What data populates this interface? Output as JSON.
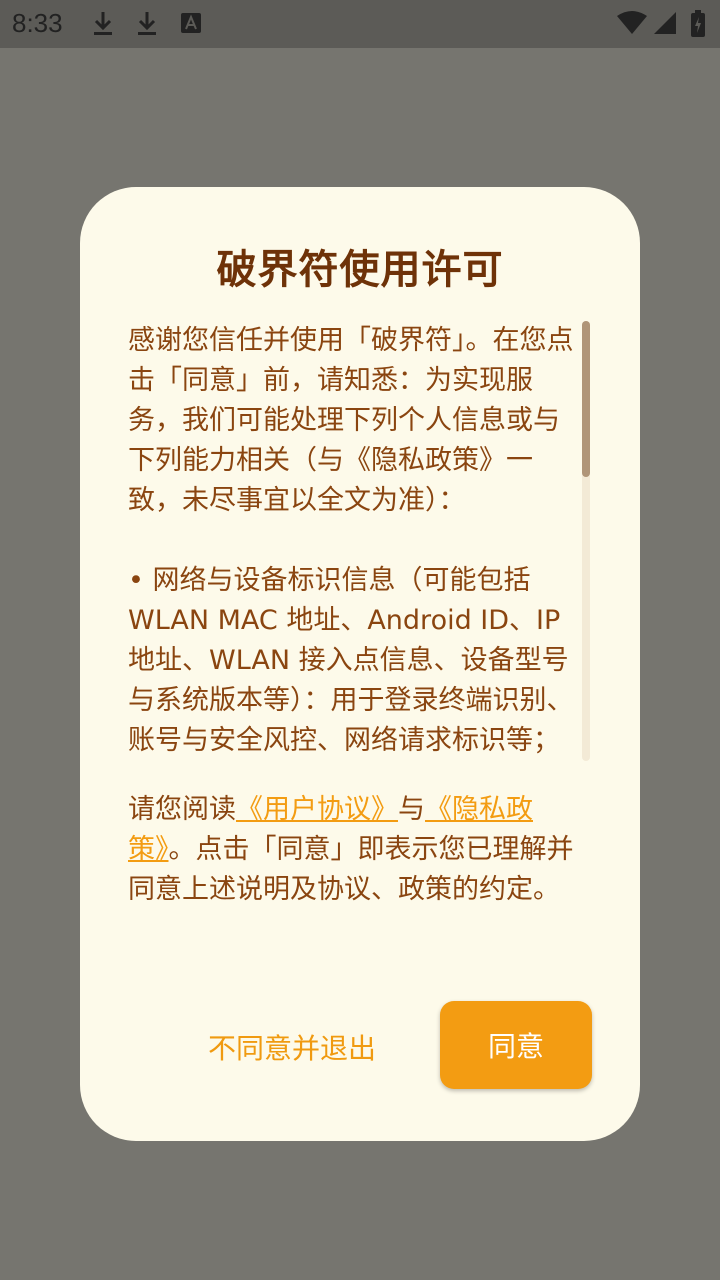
{
  "status_bar": {
    "time": "8:33",
    "icons": [
      "download-icon",
      "download-icon",
      "accessibility-a-icon",
      "wifi-icon",
      "signal-icon",
      "battery-charging-icon"
    ]
  },
  "dialog": {
    "title": "破界符使用许可",
    "body_para1": "感谢您信任并使用「破界符」。在您点击「同意」前，请知悉：为实现服务，我们可能处理下列个人信息或与下列能力相关（与《隐私政策》一致，未尽事宜以全文为准）：",
    "body_para2": "• 网络与设备标识信息（可能包括 WLAN MAC 地址、Android ID、IP 地址、WLAN 接入点信息、设备型号与系统版本等）：用于登录终端识别、账号与安全风控、网络请求标识等；",
    "consent_prefix": "请您阅读",
    "user_agreement_link": "《用户协议》",
    "consent_and": "与",
    "privacy_policy_link": "《隐私政策》",
    "consent_suffix": "。点击「同意」即表示您已理解并同意上述说明及协议、政策的约定。",
    "decline_label": "不同意并退出",
    "agree_label": "同意"
  },
  "colors": {
    "accent": "#f39c12",
    "title": "#6e3208",
    "body_text": "#8a4510",
    "dialog_bg": "#fdfaea",
    "scrim": "#76756f"
  }
}
